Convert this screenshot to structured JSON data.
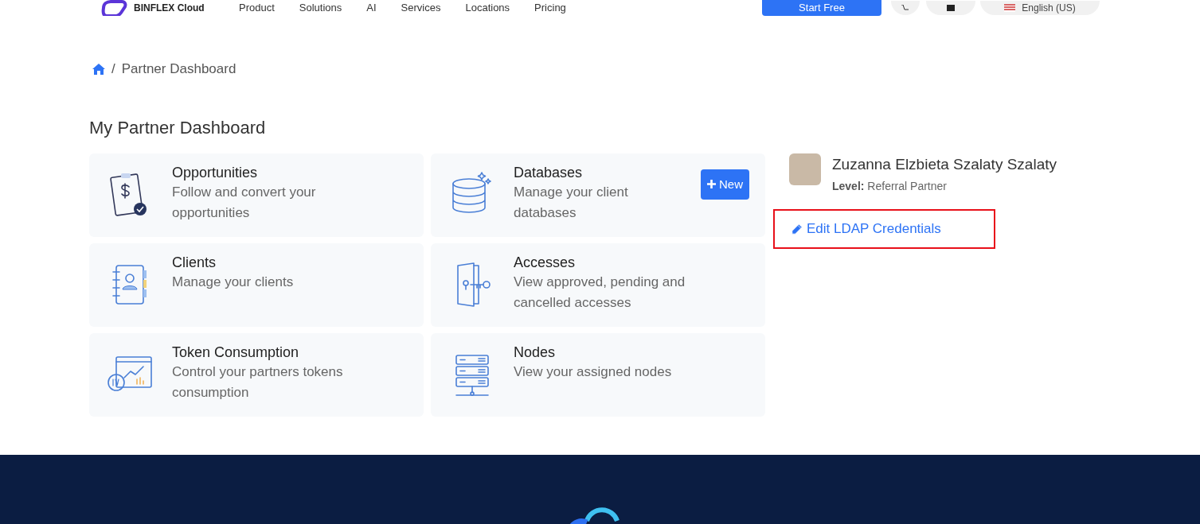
{
  "header": {
    "logo_text": "BINFLEX Cloud",
    "nav": [
      "Product",
      "Solutions",
      "AI",
      "Services",
      "Locations",
      "Pricing"
    ],
    "cta": "Start Free",
    "language": "English (US)"
  },
  "breadcrumb": [
    {
      "separator": "/",
      "label": "Partner Dashboard"
    }
  ],
  "title": "My Partner Dashboard",
  "cards": [
    {
      "kind": "opportunities",
      "title": "Opportunities",
      "description": "Follow and convert your opportunities"
    },
    {
      "kind": "databases",
      "title": "Databases",
      "description": "Manage your client databases",
      "action": "New"
    },
    {
      "kind": "clients",
      "title": "Clients",
      "description": "Manage your clients"
    },
    {
      "kind": "accesses",
      "title": "Accesses",
      "description": "View approved, pending and cancelled accesses"
    },
    {
      "kind": "tokens",
      "title": "Token Consumption",
      "description": "Control your partners tokens consumption"
    },
    {
      "kind": "nodes",
      "title": "Nodes",
      "description": "View your assigned nodes"
    }
  ],
  "profile": {
    "name": "Zuzanna Elzbieta Szalaty Szalaty",
    "level_label": "Level:",
    "level": "Referral Partner",
    "edit_link": "Edit LDAP Credentials",
    "highlighted": true
  }
}
